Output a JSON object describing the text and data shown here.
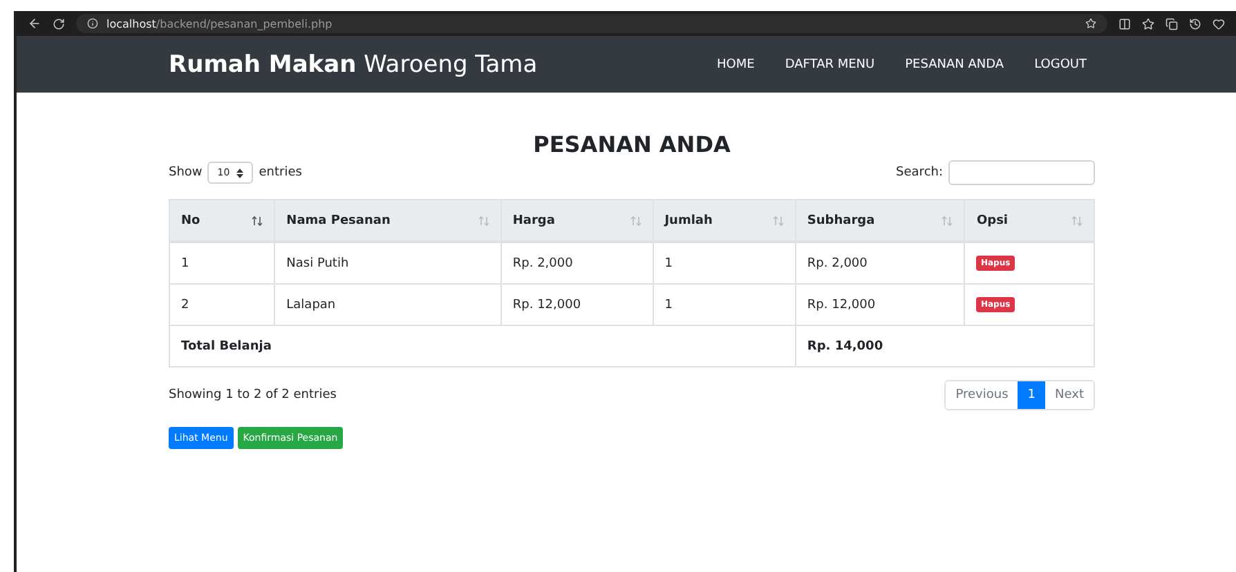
{
  "browser": {
    "url_host": "localhost",
    "url_path": "/backend/pesanan_pembeli.php"
  },
  "navbar": {
    "brand_bold": "Rumah Makan",
    "brand_rest": "Waroeng Tama",
    "links": [
      "HOME",
      "DAFTAR MENU",
      "PESANAN ANDA",
      "LOGOUT"
    ]
  },
  "title": "PESANAN ANDA",
  "length": {
    "before": "Show",
    "value": "10",
    "after": "entries"
  },
  "search": {
    "label": "Search:"
  },
  "table": {
    "columns": [
      "No",
      "Nama Pesanan",
      "Harga",
      "Jumlah",
      "Subharga",
      "Opsi"
    ],
    "rows": [
      {
        "cells": [
          "1",
          "Nasi Putih",
          "Rp. 2,000",
          "1",
          "Rp. 2,000"
        ],
        "action": "Hapus"
      },
      {
        "cells": [
          "2",
          "Lalapan",
          "Rp. 12,000",
          "1",
          "Rp. 12,000"
        ],
        "action": "Hapus"
      }
    ],
    "total": {
      "label": "Total Belanja",
      "value": "Rp. 14,000"
    }
  },
  "info": "Showing 1 to 2 of 2 entries",
  "pagination": [
    {
      "label": "Previous",
      "selected": false
    },
    {
      "label": "1",
      "selected": true
    },
    {
      "label": "Next",
      "selected": false
    }
  ],
  "buttons": [
    {
      "label": "Lihat Menu",
      "kind": "primary"
    },
    {
      "label": "Konfirmasi Pesanan",
      "kind": "success"
    }
  ]
}
